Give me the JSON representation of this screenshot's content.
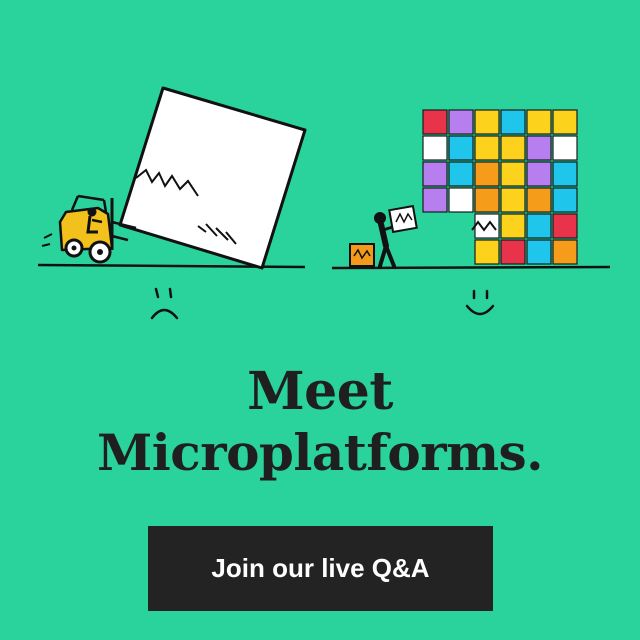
{
  "headline": {
    "line1": "Meet",
    "line2": "Microplatforms."
  },
  "cta": {
    "label": "Join our live Q&A"
  },
  "colors": {
    "background": "#2ad39b",
    "text": "#1f1f1f",
    "button_bg": "#232323",
    "button_text": "#ffffff"
  },
  "illustration": {
    "left": "forklift-pushing-giant-box",
    "left_face": "sad-face",
    "right": "person-stacking-colorful-blocks",
    "right_face": "smiley-face"
  }
}
